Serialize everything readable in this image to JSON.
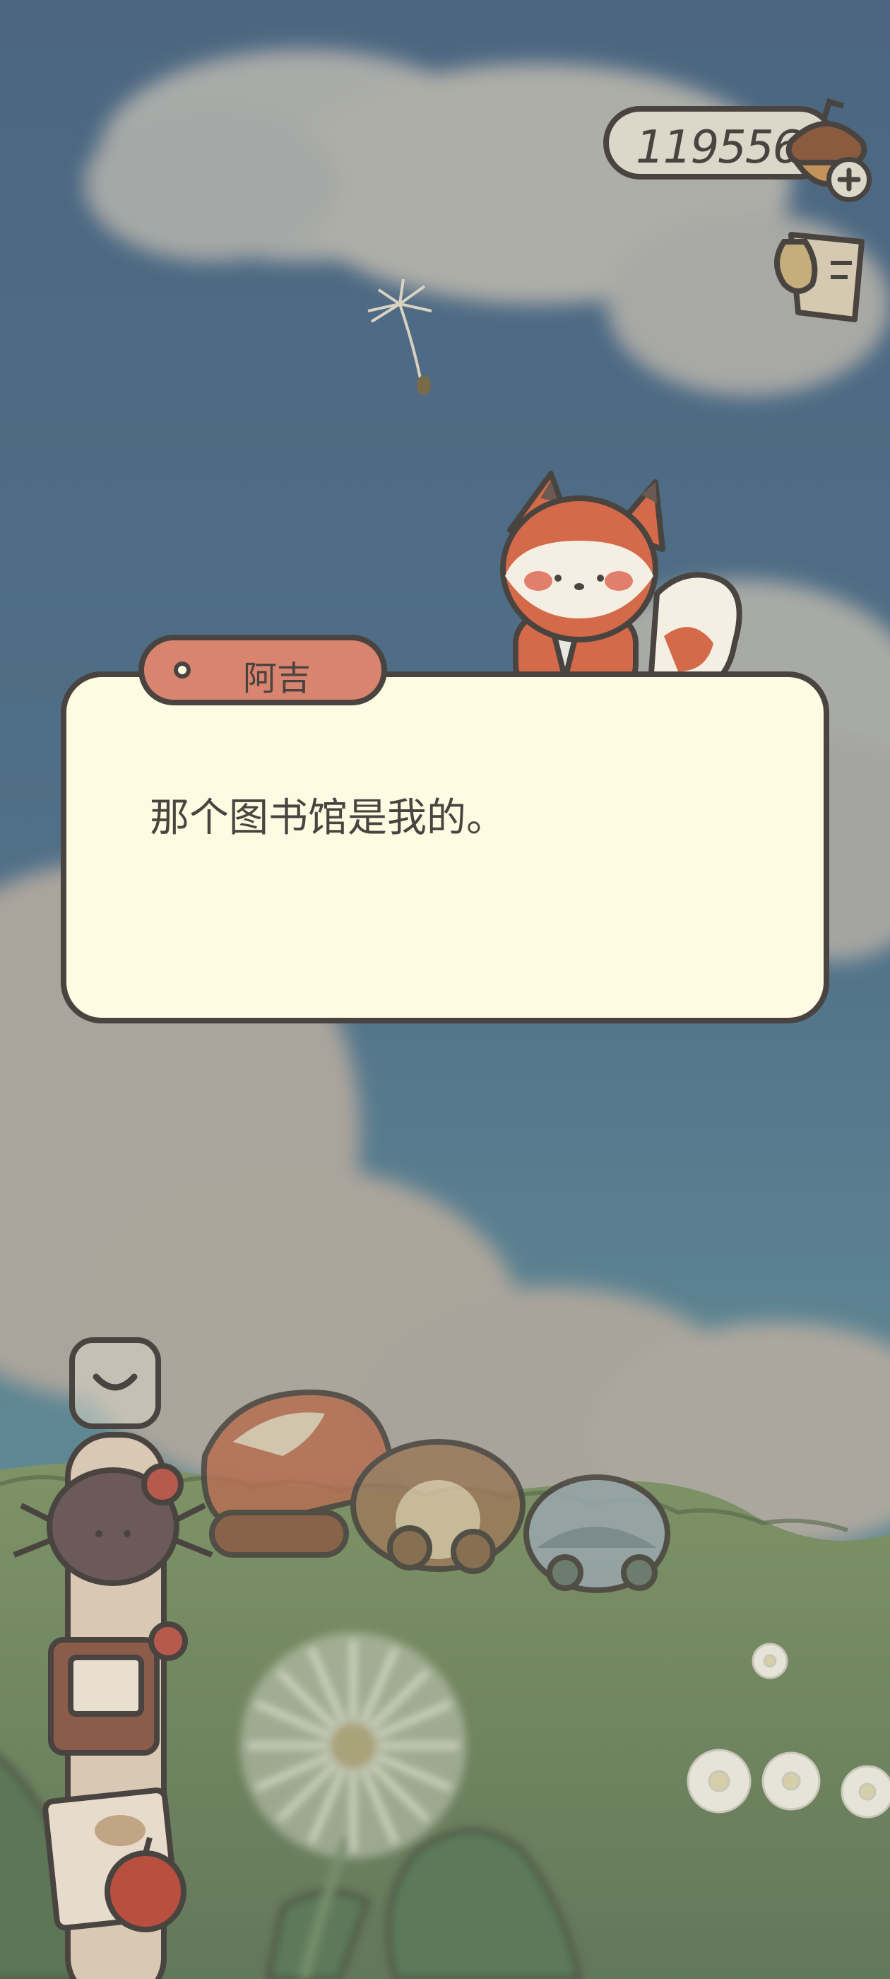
{
  "hud": {
    "acorn_count": "119556",
    "acorn_icon": "acorn-icon",
    "add_icon": "plus-icon",
    "task_icon": "scroll-icon"
  },
  "dialog": {
    "speaker": "阿吉",
    "text": "那个图书馆是我的。"
  },
  "controls": {
    "collapse_icon": "chevron-down-icon"
  },
  "colors": {
    "sky": "#4f6c86",
    "cloud": "#b7b0a4",
    "grass": "#6f845f",
    "dialog_bg": "#fffbe3",
    "tag_bg": "#d9846e",
    "outline": "#4a4440",
    "fox": "#d46a4a"
  }
}
